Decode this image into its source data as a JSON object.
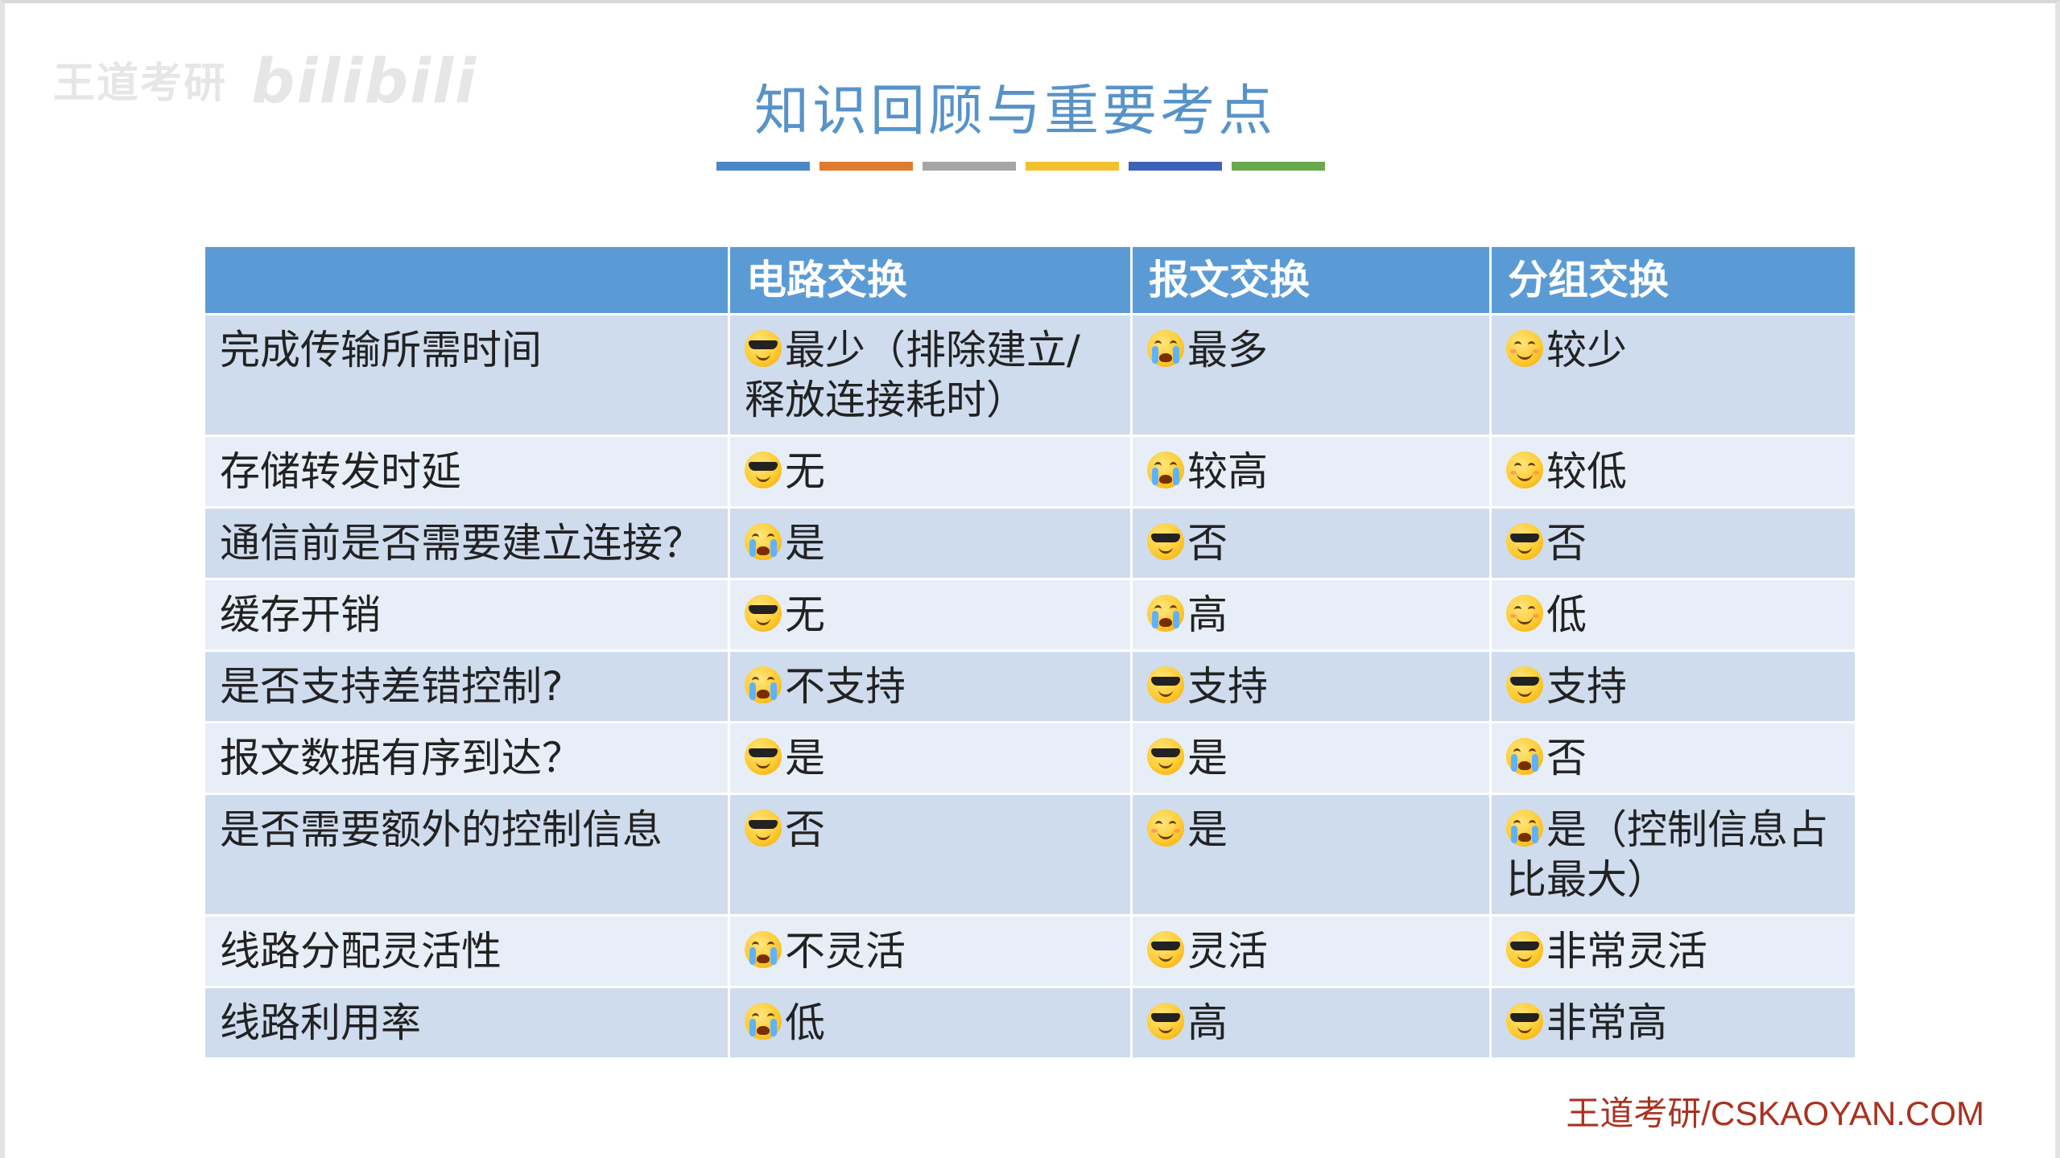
{
  "watermark": {
    "text": "王道考研",
    "brand": "bilibili"
  },
  "title": "知识回顾与重要考点",
  "color_bar": [
    "#4a86c5",
    "#e07a2e",
    "#a5a5a5",
    "#f2c12e",
    "#3e62b8",
    "#6aa84f"
  ],
  "table": {
    "headers": [
      "",
      "电路交换",
      "报文交换",
      "分组交换"
    ],
    "rows": [
      {
        "label": "完成传输所需时间",
        "cells": [
          {
            "icon": "cool",
            "text": "最少（排除建立/释放连接耗时）"
          },
          {
            "icon": "cry",
            "text": "最多"
          },
          {
            "icon": "smile",
            "text": "较少"
          }
        ]
      },
      {
        "label": "存储转发时延",
        "cells": [
          {
            "icon": "cool",
            "text": "无"
          },
          {
            "icon": "cry",
            "text": "较高"
          },
          {
            "icon": "smile",
            "text": "较低"
          }
        ]
      },
      {
        "label": "通信前是否需要建立连接？",
        "cells": [
          {
            "icon": "cry",
            "text": "是"
          },
          {
            "icon": "cool",
            "text": "否"
          },
          {
            "icon": "cool",
            "text": "否"
          }
        ]
      },
      {
        "label": "缓存开销",
        "cells": [
          {
            "icon": "cool",
            "text": "无"
          },
          {
            "icon": "cry",
            "text": "高"
          },
          {
            "icon": "smile",
            "text": "低"
          }
        ]
      },
      {
        "label": "是否支持差错控制?",
        "cells": [
          {
            "icon": "cry",
            "text": "不支持"
          },
          {
            "icon": "cool",
            "text": "支持"
          },
          {
            "icon": "cool",
            "text": "支持"
          }
        ]
      },
      {
        "label": "报文数据有序到达？",
        "cells": [
          {
            "icon": "cool",
            "text": "是"
          },
          {
            "icon": "cool",
            "text": "是"
          },
          {
            "icon": "cry",
            "text": "否"
          }
        ]
      },
      {
        "label": "是否需要额外的控制信息",
        "cells": [
          {
            "icon": "cool",
            "text": "否"
          },
          {
            "icon": "smile",
            "text": "是"
          },
          {
            "icon": "cry",
            "text": "是（控制信息占比最大）"
          }
        ]
      },
      {
        "label": "线路分配灵活性",
        "cells": [
          {
            "icon": "cry",
            "text": "不灵活"
          },
          {
            "icon": "cool",
            "text": "灵活"
          },
          {
            "icon": "cool",
            "text": "非常灵活"
          }
        ]
      },
      {
        "label": "线路利用率",
        "cells": [
          {
            "icon": "cry",
            "text": "低"
          },
          {
            "icon": "cool",
            "text": "高"
          },
          {
            "icon": "cool",
            "text": "非常高"
          }
        ]
      }
    ]
  },
  "footer": "王道考研/CSKAOYAN.COM"
}
